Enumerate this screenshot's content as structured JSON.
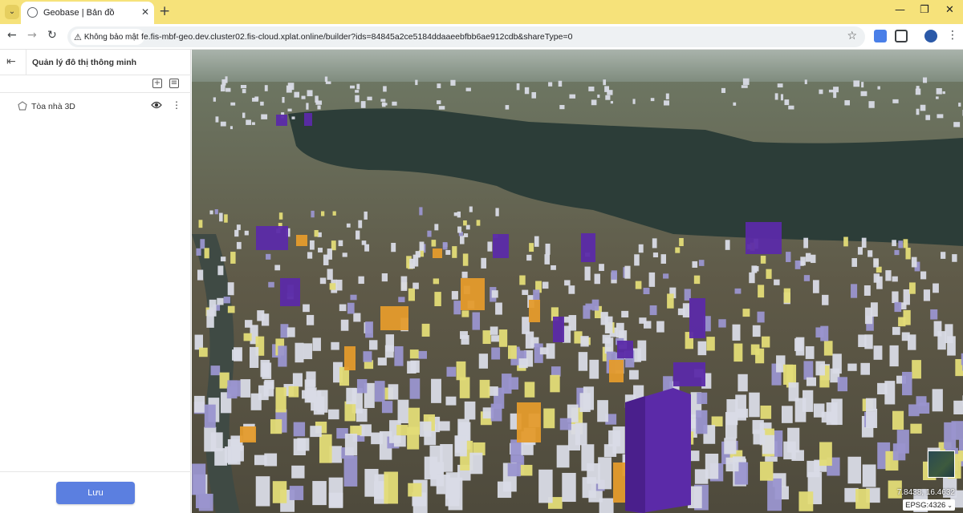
{
  "browser": {
    "tab_title": "Geobase | Bản đồ",
    "security_label": "Không bảo mật",
    "url": "fe.fis-mbf-geo.dev.cluster02.fis-cloud.xplat.online/builder?ids=84845a2ce5184ddaaeebfbb6ae912cdb&shareType=0"
  },
  "sidebar": {
    "title": "Quản lý đô thị thông minh",
    "layers": [
      {
        "label": "Tòa nhà 3D"
      }
    ],
    "save_label": "Lưu"
  },
  "map": {
    "coordinates": "7.8438, 16.4632",
    "crs": "EPSG:4326",
    "colors": {
      "building_white": "#d9dbe6",
      "building_lavender": "#9a95cf",
      "building_purple": "#5b2aa8",
      "building_orange": "#e49b2c",
      "building_yellow": "#e3dc77",
      "lake": "#2a3d38"
    }
  }
}
